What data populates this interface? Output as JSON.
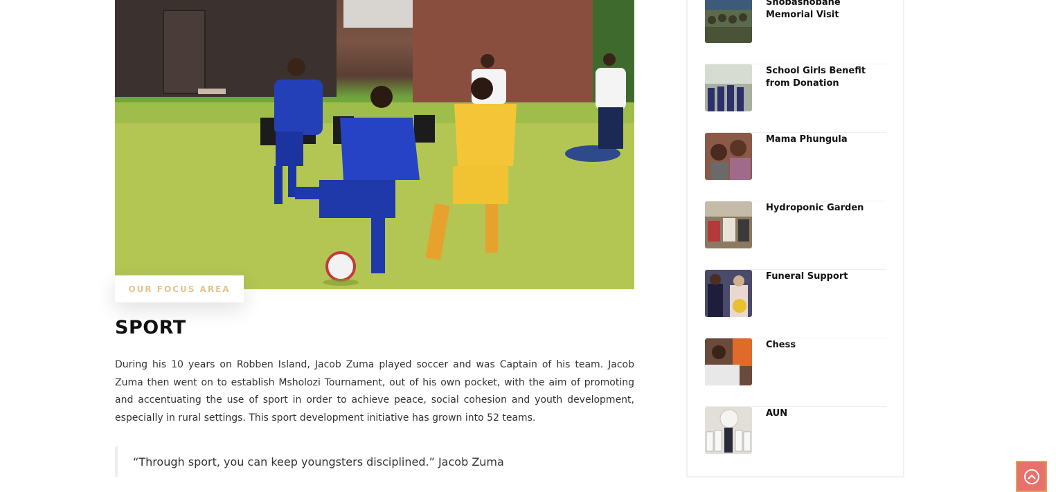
{
  "article": {
    "tag": "OUR FOCUS AREA",
    "title": "SPORT",
    "body": "During his 10 years on Robben Island, Jacob Zuma played soccer and was Captain of his team. Jacob Zuma then went on to establish Msholozi Tournament, out of his own pocket, with the aim of promoting and accentuating the use of sport in order to achieve peace, social cohesion and youth development, especially in rural settings. This sport development initiative has grown into 52 teams.",
    "quote": "“Through sport, you can keep youngsters disciplined.” Jacob Zuma"
  },
  "sidebar": {
    "items": [
      {
        "title": "Shobashobane Memorial Visit",
        "thumb_color": "#4a5a3a"
      },
      {
        "title": "School Girls Benefit from Donation",
        "thumb_color": "#6d7a6a"
      },
      {
        "title": "Mama Phungula",
        "thumb_color": "#6e4a3c"
      },
      {
        "title": "Hydroponic Garden",
        "thumb_color": "#7a6a55"
      },
      {
        "title": "Funeral Support",
        "thumb_color": "#3d3b58"
      },
      {
        "title": "Chess",
        "thumb_color": "#8a6a55"
      },
      {
        "title": "AUN",
        "thumb_color": "#c9c2c0"
      }
    ]
  },
  "back_to_top": {
    "icon": "chevron-up-circle-icon"
  }
}
